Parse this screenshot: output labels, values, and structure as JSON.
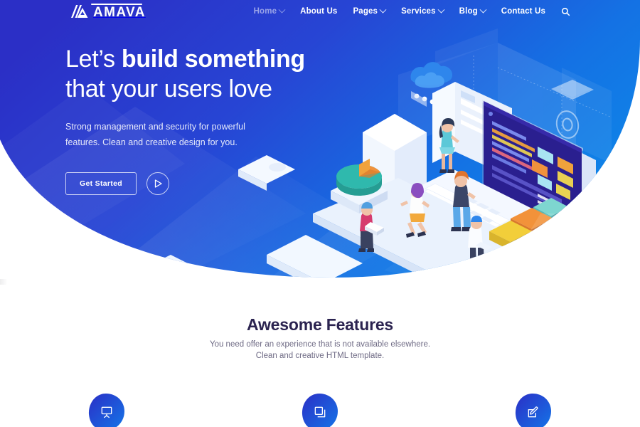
{
  "brand": {
    "logo_text": "AMAVA",
    "logo_icon": "mountain-slash-logo"
  },
  "nav": {
    "items": [
      {
        "label": "Home",
        "has_dropdown": true,
        "active": true
      },
      {
        "label": "About Us",
        "has_dropdown": false,
        "active": false
      },
      {
        "label": "Pages",
        "has_dropdown": true,
        "active": false
      },
      {
        "label": "Services",
        "has_dropdown": true,
        "active": false
      },
      {
        "label": "Blog",
        "has_dropdown": true,
        "active": false
      },
      {
        "label": "Contact Us",
        "has_dropdown": false,
        "active": false
      }
    ],
    "search_icon": "search-icon"
  },
  "hero": {
    "headline_part1": "Let’s ",
    "headline_bold": "build something",
    "headline_line2": "that your users love",
    "subtitle_line1": "Strong management and security for powerful",
    "subtitle_line2": "features. Clean and creative design for you.",
    "cta_label": "Get Started",
    "play_icon": "play-icon",
    "illustration": "isometric-team-laptop-illustration",
    "gradient_from": "#2b2fc6",
    "gradient_to": "#0e87e8"
  },
  "features": {
    "title": "Awesome Features",
    "subtitle_line1": "You need offer an experience that is not available elsewhere.",
    "subtitle_line2": "Clean and creative HTML template.",
    "title_color": "#2b2350",
    "items": [
      {
        "icon": "easel-board-icon"
      },
      {
        "icon": "copy-layers-icon"
      },
      {
        "icon": "pencil-edit-icon"
      }
    ]
  }
}
